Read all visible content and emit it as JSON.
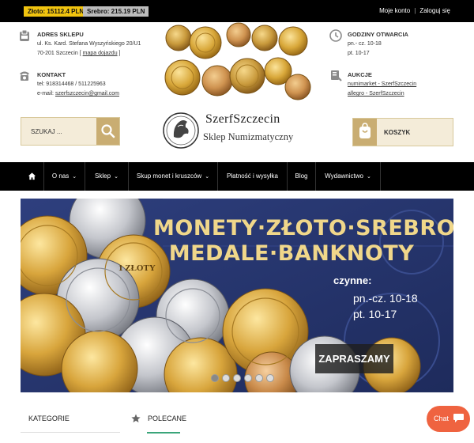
{
  "topbar": {
    "gold_price": "Złoto: 15112.4 PLN",
    "silver_price": "Srebro: 215.19 PLN",
    "account_link": "Moje konto",
    "login_link": "Zaloguj się",
    "separator": "|"
  },
  "address": {
    "title": "ADRES SKLEPU",
    "line1": "ul. Ks. Kard. Stefana Wyszyńskiego 20/U1",
    "line2": "70-201 Szczecin",
    "map_link": "mapa dojazdu"
  },
  "contact": {
    "title": "KONTAKT",
    "phone": "tel: 918314468 / 511225963",
    "email_label": "e-mail:",
    "email": "szerfszczecin@gmail.com"
  },
  "hours": {
    "title": "GODZINY OTWARCIA",
    "line1": "pn.- cz. 10-18",
    "line2": "pt. 10-17"
  },
  "auctions": {
    "title": "AUKCJE",
    "link1": "numimarket - SzerfSzczecin",
    "link2": "allegro - SzerfSzczecin"
  },
  "logo": {
    "name": "SzerfSzczecin",
    "subtitle": "Sklep Numizmatyczny"
  },
  "search": {
    "placeholder": "SZUKAJ ..."
  },
  "cart": {
    "label": "KOSZYK"
  },
  "nav": {
    "items": [
      {
        "label": "O nas"
      },
      {
        "label": "Sklep"
      },
      {
        "label": "Skup monet i kruszców"
      },
      {
        "label": "Płatność i wysyłka"
      },
      {
        "label": "Blog"
      },
      {
        "label": "Wydawnictwo"
      }
    ]
  },
  "banner": {
    "headline_line1": "MONETY·ZŁOTO·SREBRO",
    "headline_line2": "MEDALE·BANKNOTY",
    "open_label": "czynne:",
    "hours1": "pn.-cz. 10-18",
    "hours2": "pt. 10-17",
    "cta": "ZAPRASZAMY",
    "coin_text": "1 ZŁOTY",
    "slides_total": 6,
    "slides_active": 1
  },
  "sidebar": {
    "categories_title": "KATEGORIE"
  },
  "main": {
    "featured_title": "POLECANE"
  },
  "chat": {
    "label": "Chat"
  },
  "colors": {
    "gold_badge": "#f1c40f",
    "silver_badge": "#bcbcbc",
    "accent_gold": "#c9ad72",
    "banner_navy": "#273770",
    "chat_orange": "#ef6340",
    "featured_green": "#3aa57a"
  }
}
